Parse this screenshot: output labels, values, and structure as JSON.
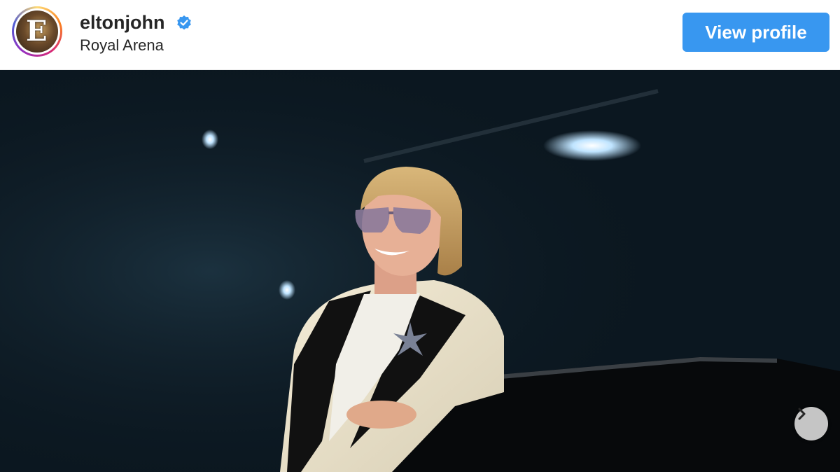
{
  "header": {
    "username": "eltonjohn",
    "location": "Royal Arena",
    "view_profile_label": "View profile",
    "verified_icon": "verified-badge-icon",
    "avatar_letter": "E"
  },
  "photo": {
    "next_icon": "chevron-right-icon"
  },
  "colors": {
    "button": "#3897f0",
    "verified": "#3897f0",
    "text": "#262626"
  }
}
